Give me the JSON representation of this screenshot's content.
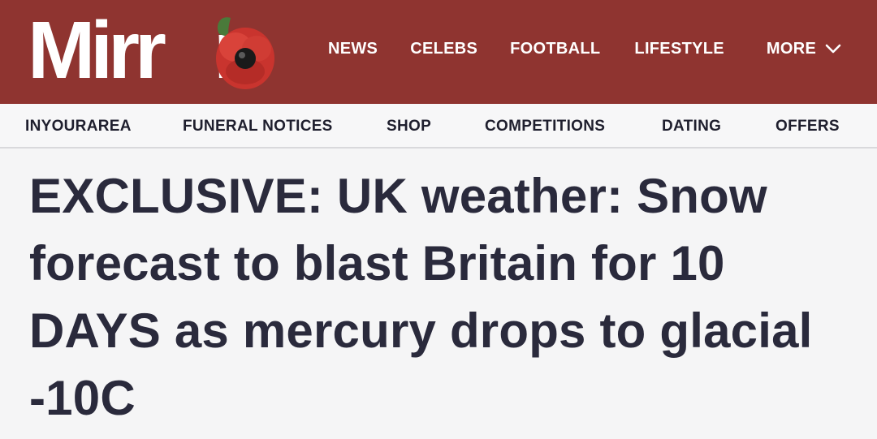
{
  "brand": {
    "logo_text": "Mirr",
    "logo_text_end": "r",
    "poppy_icon": "poppy-icon",
    "header_bg": "#8f3430"
  },
  "main_nav": {
    "items": [
      "NEWS",
      "CELEBS",
      "FOOTBALL",
      "LIFESTYLE"
    ],
    "more_label": "MORE",
    "more_icon": "chevron-down-icon"
  },
  "sub_nav": {
    "items": [
      "INYOURAREA",
      "FUNERAL NOTICES",
      "SHOP",
      "COMPETITIONS",
      "DATING",
      "OFFERS"
    ]
  },
  "article": {
    "headline": "EXCLUSIVE: UK weather: Snow forecast to blast Britain for 10 DAYS as mercury drops to glacial -10C"
  }
}
